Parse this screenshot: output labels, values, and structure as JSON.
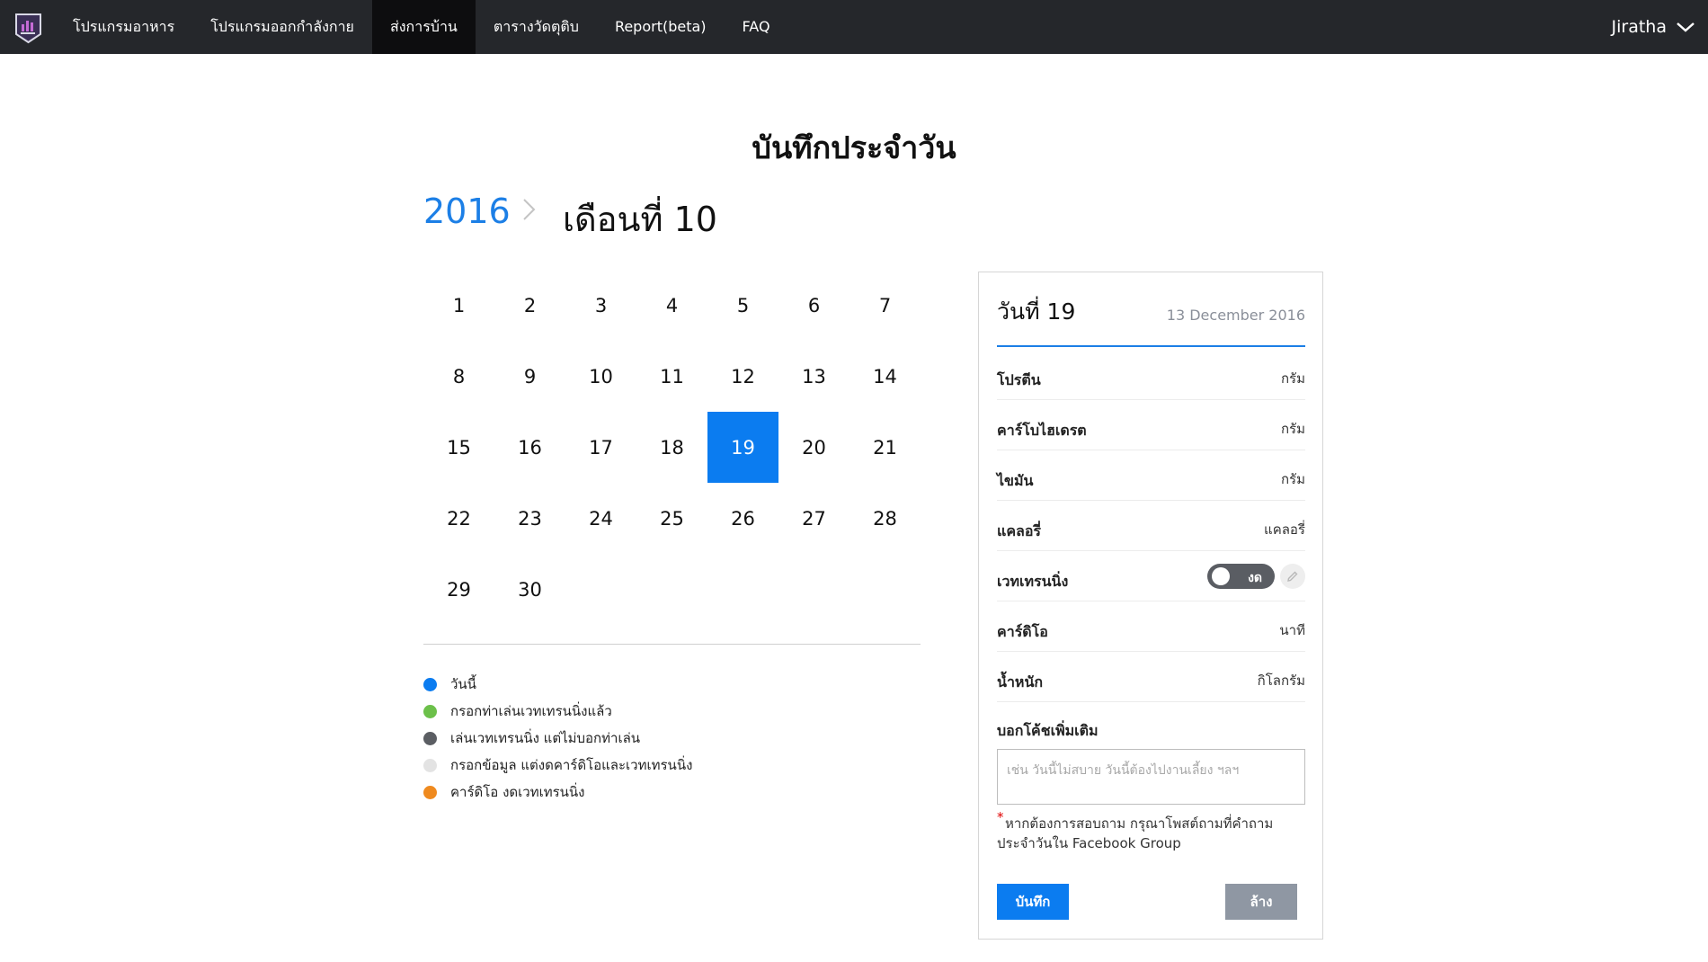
{
  "nav": {
    "items": [
      {
        "label": "โปรแกรมอาหาร"
      },
      {
        "label": "โปรแกรมออกกำลังกาย"
      },
      {
        "label": "ส่งการบ้าน"
      },
      {
        "label": "ตารางวัดตุติบ"
      },
      {
        "label": "Report(beta)"
      },
      {
        "label": "FAQ"
      }
    ],
    "active_index": 2,
    "user_name": "Jiratha"
  },
  "page": {
    "title": "บันทึกประจำวัน",
    "year": "2016",
    "month": "เดือนที่ 10"
  },
  "calendar": {
    "days": [
      "1",
      "2",
      "3",
      "4",
      "5",
      "6",
      "7",
      "8",
      "9",
      "10",
      "11",
      "12",
      "13",
      "14",
      "15",
      "16",
      "17",
      "18",
      "19",
      "20",
      "21",
      "22",
      "23",
      "24",
      "25",
      "26",
      "27",
      "28",
      "29",
      "30"
    ],
    "selected_day": "19"
  },
  "legend": [
    {
      "label": "วันนี้",
      "color": "#0b7cf0"
    },
    {
      "label": "กรอกท่าเล่นเวทเทรนนิ่งแล้ว",
      "color": "#6cc04a"
    },
    {
      "label": "เล่นเวทเทรนนิ่ง แต่ไม่บอกท่าเล่น",
      "color": "#5b5e63"
    },
    {
      "label": "กรอกข้อมูล แต่งดคาร์ดิโอและเวทเทรนนิ่ง",
      "color": "#e3e3e3"
    },
    {
      "label": "คาร์ดิโอ งดเวทเทรนนิ่ง",
      "color": "#ef8a1f"
    }
  ],
  "panel": {
    "day_title": "วันที่ 19",
    "date_text": "13 December 2016",
    "rows": [
      {
        "label": "โปรตีน",
        "unit": "กรัม"
      },
      {
        "label": "คาร์โบไฮเดรต",
        "unit": "กรัม"
      },
      {
        "label": "ไขมัน",
        "unit": "กรัม"
      },
      {
        "label": "แคลอรี่",
        "unit": "แคลอรี่"
      },
      {
        "label": "เวทเทรนนิ่ง",
        "toggle_text": "งด"
      },
      {
        "label": "คาร์ดิโอ",
        "unit": "นาที"
      },
      {
        "label": "น้ำหนัก",
        "unit": "กิโลกรัม"
      }
    ],
    "notes_label": "บอกโค้ชเพิ่มเติม",
    "notes_placeholder": "เช่น วันนี้ไม่สบาย วันนี้ต้องไปงานเลี้ยง ฯลฯ",
    "note_star": "*",
    "note_text": "หากต้องการสอบถาม กรุณาโพสต์ถามที่คำถามประจำวันใน Facebook Group",
    "save_label": "บันทึก",
    "clear_label": "ล้าง"
  },
  "colors": {
    "accent": "#0b7cf0",
    "topbar": "#25272b",
    "clear_button": "#8f97a3"
  },
  "icons": [
    "app-logo-icon",
    "chevron-down-icon",
    "chevron-right-icon",
    "pencil-icon"
  ]
}
